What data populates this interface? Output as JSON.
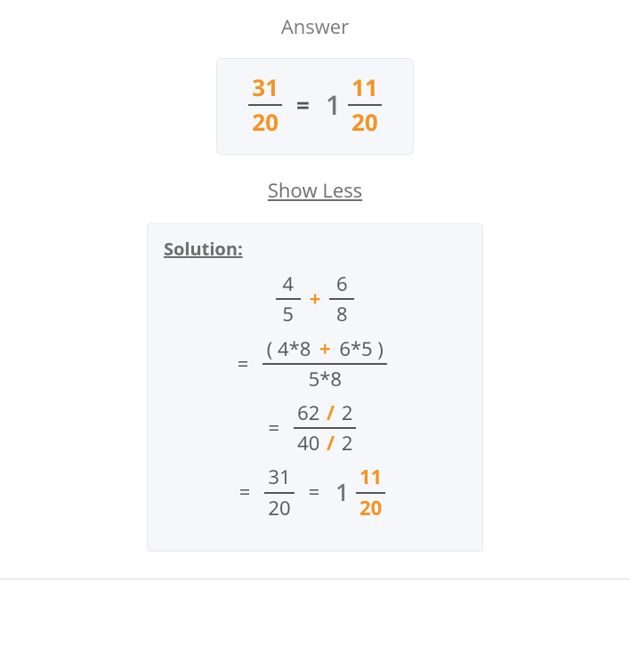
{
  "answer_label": "Answer",
  "answer": {
    "left_num": "31",
    "left_den": "20",
    "eq": "=",
    "whole": "1",
    "right_num": "11",
    "right_den": "20"
  },
  "show_less": "Show Less",
  "solution_label": "Solution:",
  "steps": {
    "s1": {
      "a_num": "4",
      "a_den": "5",
      "plus": "+",
      "b_num": "6",
      "b_den": "8"
    },
    "s2": {
      "eq": "=",
      "num_l": "( 4*8",
      "num_plus": "+",
      "num_r": "6*5 )",
      "den": "5*8"
    },
    "s3": {
      "eq": "=",
      "num_a": "62",
      "num_slash": "/",
      "num_b": "2",
      "den_a": "40",
      "den_slash": "/",
      "den_b": "2"
    },
    "s4": {
      "eq1": "=",
      "f_num": "31",
      "f_den": "20",
      "eq2": "=",
      "whole": "1",
      "m_num": "11",
      "m_den": "20"
    }
  }
}
